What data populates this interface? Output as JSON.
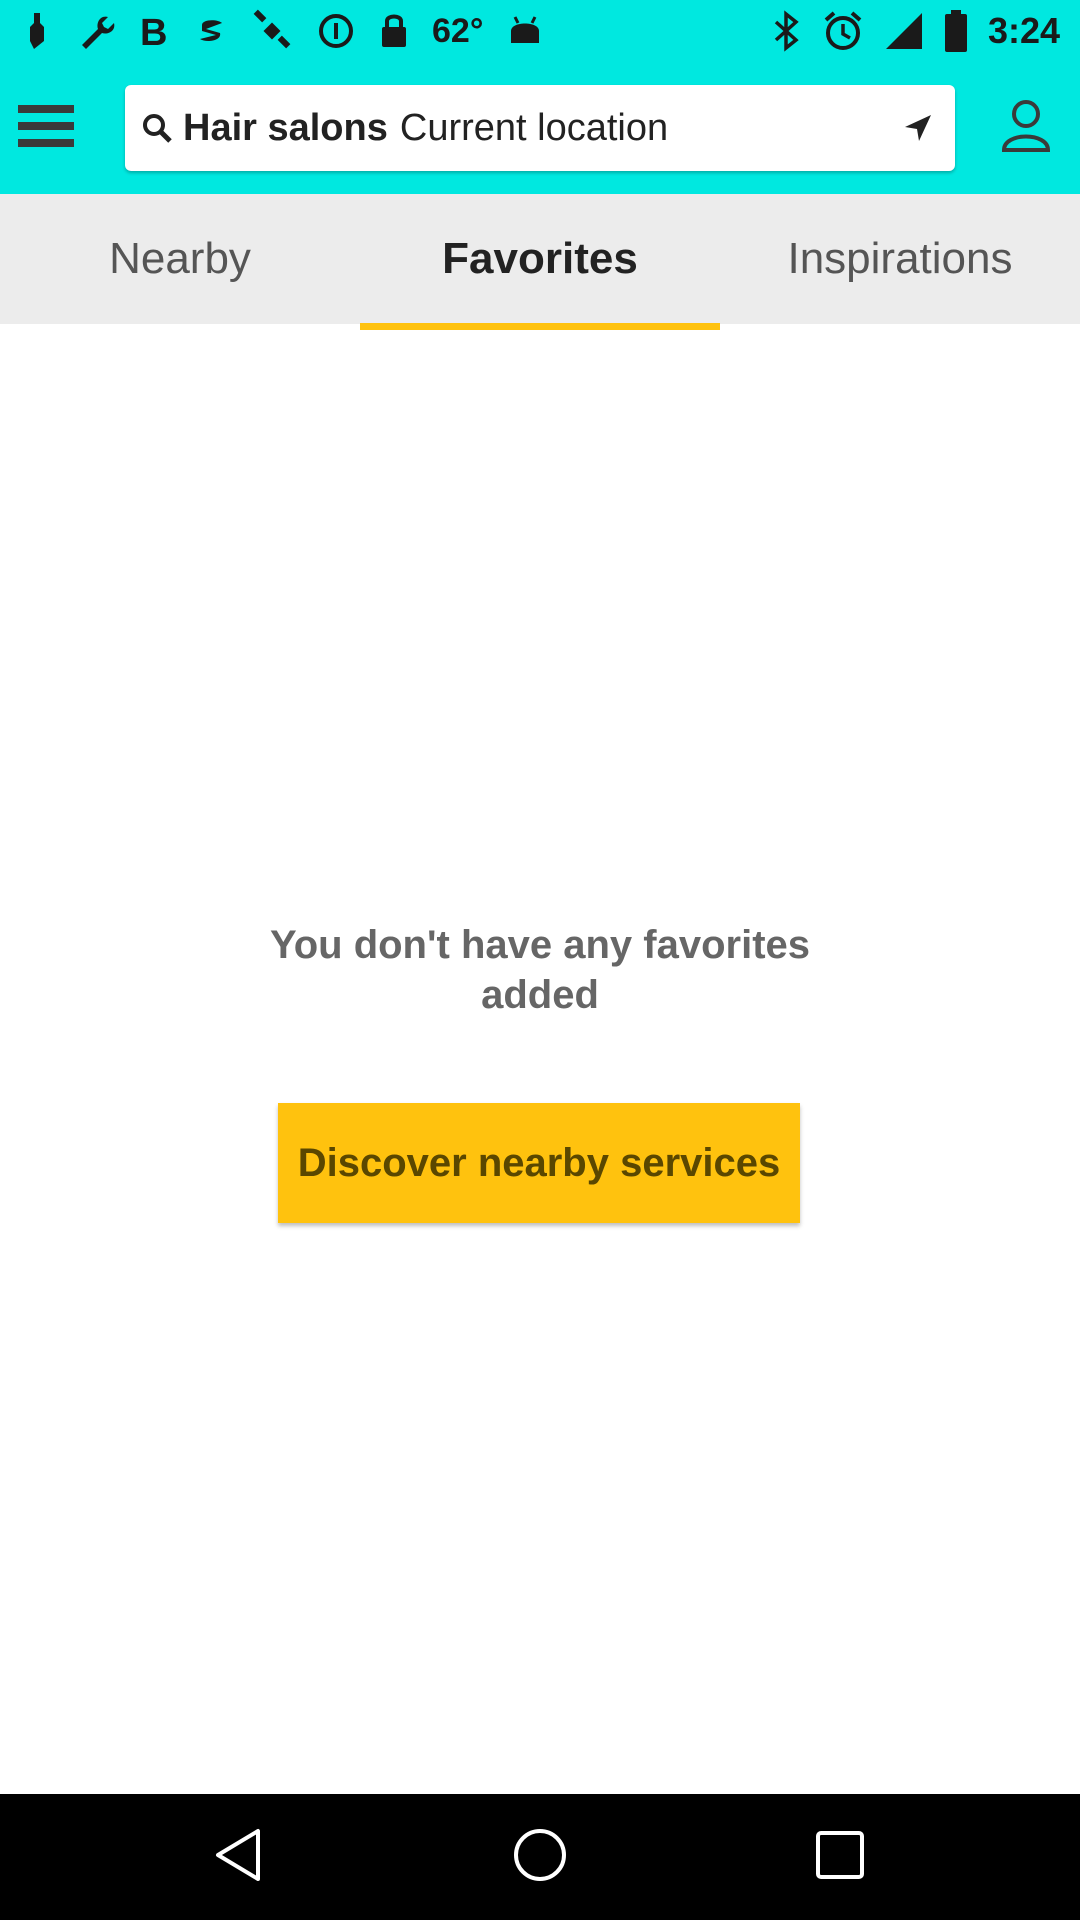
{
  "status_bar": {
    "temperature": "62°",
    "time": "3:24"
  },
  "header": {
    "search_query": "Hair salons",
    "search_location": "Current location"
  },
  "tabs": [
    {
      "label": "Nearby",
      "active": false
    },
    {
      "label": "Favorites",
      "active": true
    },
    {
      "label": "Inspirations",
      "active": false
    }
  ],
  "empty_state": {
    "message": "You don't have any favorites added",
    "button_label": "Discover nearby services"
  },
  "colors": {
    "header_background": "#00e8e0",
    "accent": "#ffc20e",
    "tab_background": "#ececec"
  },
  "icons": {
    "status_left": [
      "notification-wrench-icon",
      "bold-b-icon",
      "swiftkey-icon",
      "satellite-icon",
      "data-saver-icon",
      "lock-icon",
      "android-icon"
    ],
    "status_right": [
      "bluetooth-icon",
      "alarm-icon",
      "signal-icon",
      "battery-icon"
    ],
    "header": [
      "menu-icon",
      "search-icon",
      "location-arrow-icon",
      "profile-icon"
    ],
    "nav": [
      "back-icon",
      "home-icon",
      "recents-icon"
    ]
  }
}
